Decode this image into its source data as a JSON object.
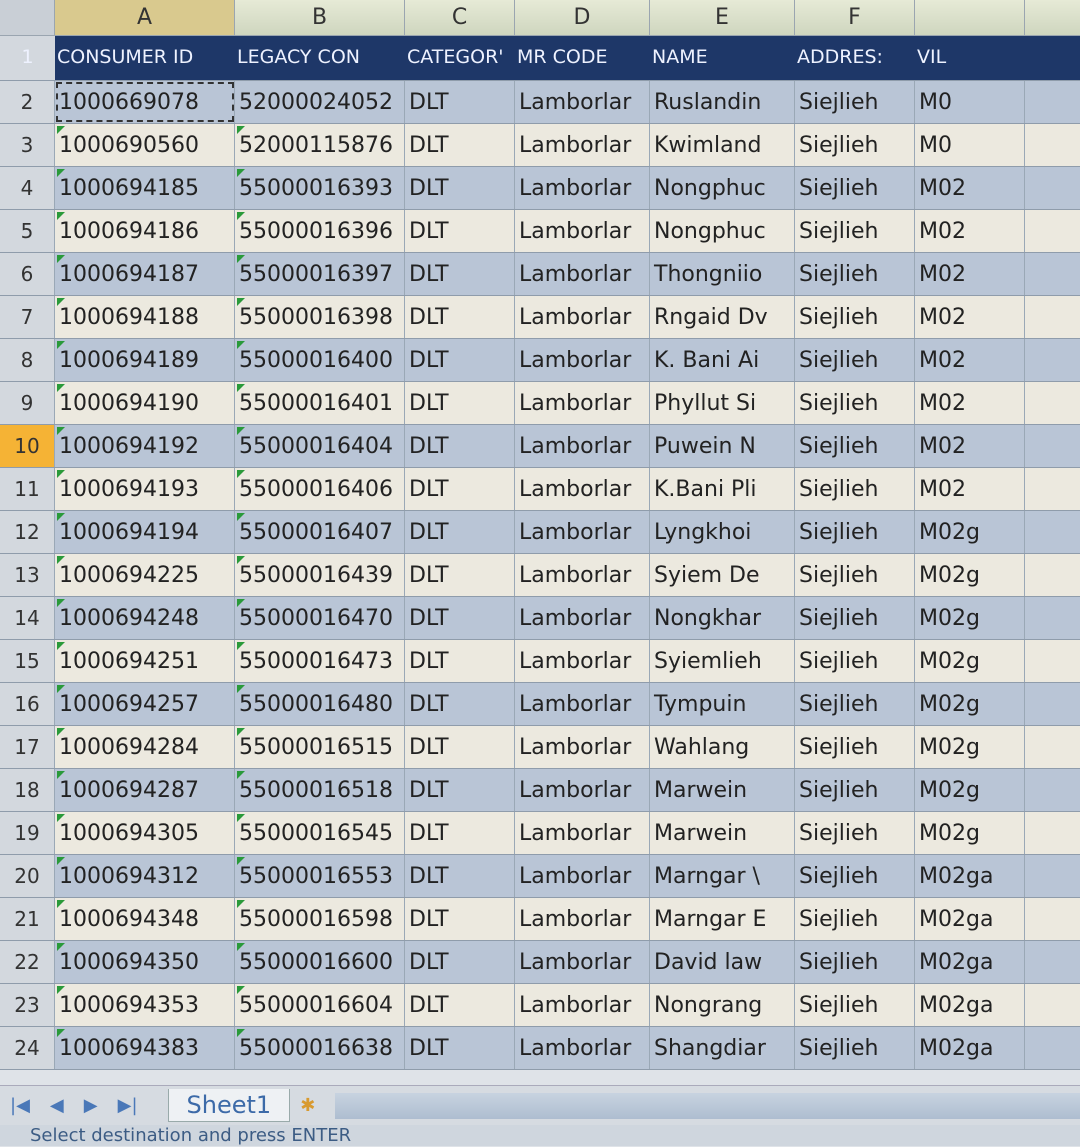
{
  "columns": [
    "A",
    "B",
    "C",
    "D",
    "E",
    "F"
  ],
  "header_row": {
    "num": "1",
    "cells": [
      "CONSUMER ID",
      "LEGACY CON",
      "CATEGOR'",
      "MR CODE",
      "NAME",
      "ADDRES:",
      "VIL"
    ]
  },
  "rows": [
    {
      "num": "2",
      "a": "1000669078",
      "b": "52000024052",
      "c": "DLT",
      "d": "Lamborlar",
      "e": "Ruslandin",
      "f": "Siejlieh",
      "g": "M0"
    },
    {
      "num": "3",
      "a": "1000690560",
      "b": "52000115876",
      "c": "DLT",
      "d": "Lamborlar",
      "e": "Kwimland",
      "f": "Siejlieh",
      "g": "M0"
    },
    {
      "num": "4",
      "a": "1000694185",
      "b": "55000016393",
      "c": "DLT",
      "d": "Lamborlar",
      "e": "Nongphuc",
      "f": "Siejlieh",
      "g": "M02"
    },
    {
      "num": "5",
      "a": "1000694186",
      "b": "55000016396",
      "c": "DLT",
      "d": "Lamborlar",
      "e": "Nongphuc",
      "f": "Siejlieh",
      "g": "M02"
    },
    {
      "num": "6",
      "a": "1000694187",
      "b": "55000016397",
      "c": "DLT",
      "d": "Lamborlar",
      "e": "Thongniio",
      "f": "Siejlieh",
      "g": "M02"
    },
    {
      "num": "7",
      "a": "1000694188",
      "b": "55000016398",
      "c": "DLT",
      "d": "Lamborlar",
      "e": "Rngaid Dv",
      "f": "Siejlieh",
      "g": "M02"
    },
    {
      "num": "8",
      "a": "1000694189",
      "b": "55000016400",
      "c": "DLT",
      "d": "Lamborlar",
      "e": "K. Bani Ai",
      "f": "Siejlieh",
      "g": "M02"
    },
    {
      "num": "9",
      "a": "1000694190",
      "b": "55000016401",
      "c": "DLT",
      "d": "Lamborlar",
      "e": "Phyllut Si",
      "f": "Siejlieh",
      "g": "M02"
    },
    {
      "num": "10",
      "a": "1000694192",
      "b": "55000016404",
      "c": "DLT",
      "d": "Lamborlar",
      "e": "Puwein N",
      "f": "Siejlieh",
      "g": "M02"
    },
    {
      "num": "11",
      "a": "1000694193",
      "b": "55000016406",
      "c": "DLT",
      "d": "Lamborlar",
      "e": "K.Bani Pli",
      "f": "Siejlieh",
      "g": "M02"
    },
    {
      "num": "12",
      "a": "1000694194",
      "b": "55000016407",
      "c": "DLT",
      "d": "Lamborlar",
      "e": "Lyngkhoi",
      "f": "Siejlieh",
      "g": "M02g"
    },
    {
      "num": "13",
      "a": "1000694225",
      "b": "55000016439",
      "c": "DLT",
      "d": "Lamborlar",
      "e": "Syiem De",
      "f": "Siejlieh",
      "g": "M02g"
    },
    {
      "num": "14",
      "a": "1000694248",
      "b": "55000016470",
      "c": "DLT",
      "d": "Lamborlar",
      "e": "Nongkhar",
      "f": "Siejlieh",
      "g": "M02g"
    },
    {
      "num": "15",
      "a": "1000694251",
      "b": "55000016473",
      "c": "DLT",
      "d": "Lamborlar",
      "e": "Syiemlieh",
      "f": "Siejlieh",
      "g": "M02g"
    },
    {
      "num": "16",
      "a": "1000694257",
      "b": "55000016480",
      "c": "DLT",
      "d": "Lamborlar",
      "e": "Tympuin",
      "f": "Siejlieh",
      "g": "M02g"
    },
    {
      "num": "17",
      "a": "1000694284",
      "b": "55000016515",
      "c": "DLT",
      "d": "Lamborlar",
      "e": "Wahlang",
      "f": "Siejlieh",
      "g": "M02g"
    },
    {
      "num": "18",
      "a": "1000694287",
      "b": "55000016518",
      "c": "DLT",
      "d": "Lamborlar",
      "e": "Marwein",
      "f": "Siejlieh",
      "g": "M02g"
    },
    {
      "num": "19",
      "a": "1000694305",
      "b": "55000016545",
      "c": "DLT",
      "d": "Lamborlar",
      "e": "Marwein",
      "f": "Siejlieh",
      "g": "M02g"
    },
    {
      "num": "20",
      "a": "1000694312",
      "b": "55000016553",
      "c": "DLT",
      "d": "Lamborlar",
      "e": "Marngar \\",
      "f": "Siejlieh",
      "g": "M02ga"
    },
    {
      "num": "21",
      "a": "1000694348",
      "b": "55000016598",
      "c": "DLT",
      "d": "Lamborlar",
      "e": "Marngar E",
      "f": "Siejlieh",
      "g": "M02ga"
    },
    {
      "num": "22",
      "a": "1000694350",
      "b": "55000016600",
      "c": "DLT",
      "d": "Lamborlar",
      "e": "David law",
      "f": "Siejlieh",
      "g": "M02ga"
    },
    {
      "num": "23",
      "a": "1000694353",
      "b": "55000016604",
      "c": "DLT",
      "d": "Lamborlar",
      "e": "Nongrang",
      "f": "Siejlieh",
      "g": "M02ga"
    },
    {
      "num": "24",
      "a": "1000694383",
      "b": "55000016638",
      "c": "DLT",
      "d": "Lamborlar",
      "e": "Shangdiar",
      "f": "Siejlieh",
      "g": "M02ga"
    }
  ],
  "active_row": "10",
  "sheet_tab": "Sheet1",
  "status_text": "Select destination and press ENTER",
  "colors": {
    "header_bg": "#1e3768",
    "row_even": "#b9c5d6",
    "row_odd": "#ece9df",
    "active_row_header": "#f5b335"
  }
}
